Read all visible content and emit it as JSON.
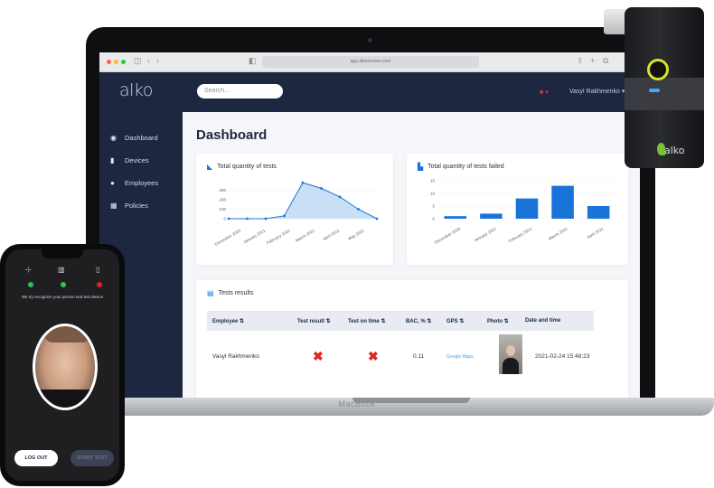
{
  "browser": {
    "url": "app.alkoscreen.com"
  },
  "header": {
    "logo": "alko",
    "search_placeholder": "Search...",
    "language": "▾",
    "user": "Vasyl Rakhmenko ▾"
  },
  "sidebar": {
    "items": [
      {
        "label": "Dashboard",
        "icon": "palette-icon"
      },
      {
        "label": "Devices",
        "icon": "device-icon"
      },
      {
        "label": "Employees",
        "icon": "user-icon"
      },
      {
        "label": "Policies",
        "icon": "table-icon"
      }
    ]
  },
  "main": {
    "title": "Dashboard"
  },
  "cards": {
    "tests_title": "Total quantity of tests",
    "failed_title": "Total quantity of tests failed",
    "results_title": "Tests results"
  },
  "chart_data": [
    {
      "type": "area",
      "title": "Total quantity of tests",
      "categories": [
        "December 2020",
        "January 2021",
        "February 2021",
        "March 2021",
        "April 2021",
        "May 2021"
      ],
      "x": [
        0,
        1,
        2,
        3,
        4,
        5,
        6,
        7,
        8
      ],
      "values": [
        0,
        0,
        0,
        30,
        380,
        320,
        230,
        100,
        0
      ],
      "ylim": [
        0,
        400
      ],
      "yticks": [
        "0",
        "100",
        "200",
        "300"
      ],
      "color": "#1a73d9",
      "fill": "#c9dff5"
    },
    {
      "type": "bar",
      "title": "Total quantity of tests failed",
      "categories": [
        "December 2020",
        "January 2021",
        "February 2021",
        "March 2021",
        "April 2021"
      ],
      "values": [
        1,
        2,
        8,
        13,
        5
      ],
      "ylim": [
        0,
        15
      ],
      "yticks": [
        "0",
        "5",
        "10",
        "15"
      ],
      "color": "#1a73d9"
    }
  ],
  "table": {
    "headers": [
      "Employee ⇅",
      "Test result ⇅",
      "Test on time ⇅",
      "BAC, % ⇅",
      "GPS ⇅",
      "Photo ⇅",
      "Date and time"
    ],
    "rows": [
      {
        "employee": "Vasyl Rakhmenko",
        "result": "✖",
        "on_time": "✖",
        "bac": "0.11",
        "gps": "Google Maps",
        "datetime": "2021-02-24 15:48:23"
      }
    ]
  },
  "laptop": {
    "brand": "MacBook"
  },
  "device": {
    "logo": "alko"
  },
  "phone": {
    "instruction": "We try recognize your person and test device",
    "logout": "LOG OUT",
    "start": "START TEST",
    "status_colors": [
      "#2ec25b",
      "#2ec25b",
      "#e0261f"
    ]
  }
}
